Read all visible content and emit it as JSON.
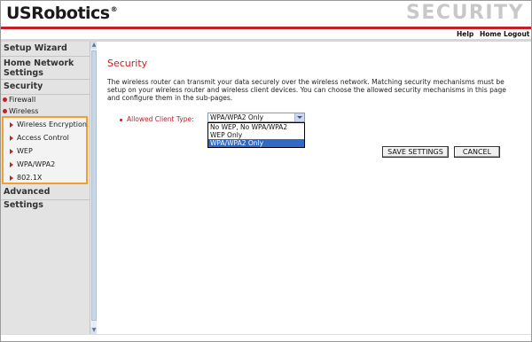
{
  "brand": {
    "logo": "USRobotics",
    "logo_mark": "®",
    "page_word": "SECURITY"
  },
  "colors": {
    "accent": "#c61e26",
    "highlight": "#f0a030",
    "selection": "#3169c6"
  },
  "top_nav": {
    "help": "Help",
    "home": "Home",
    "logout": "Logout"
  },
  "sidebar": {
    "setup_wizard": "Setup Wizard",
    "home_network_settings": "Home Network Settings",
    "security": "Security",
    "firewall": "Firewall",
    "wireless": "Wireless",
    "wireless_items": [
      "Wireless Encryption",
      "Access Control",
      "WEP",
      "WPA/WPA2",
      "802.1X"
    ],
    "advanced_settings": "Advanced Settings"
  },
  "main": {
    "title": "Security",
    "description": "The wireless router can transmit your data securely over the wireless network. Matching security mechanisms must be setup on your wireless router and wireless client devices. You can choose the allowed security mechanisms in this page and configure them in the sub-pages.",
    "allowed_client_type_label": "Allowed Client Type:",
    "allowed_client_type_value": "WPA/WPA2 Only",
    "allowed_client_type_options": [
      "No WEP, No WPA/WPA2",
      "WEP Only",
      "WPA/WPA2 Only"
    ],
    "save_button": "SAVE SETTINGS",
    "cancel_button": "CANCEL"
  }
}
